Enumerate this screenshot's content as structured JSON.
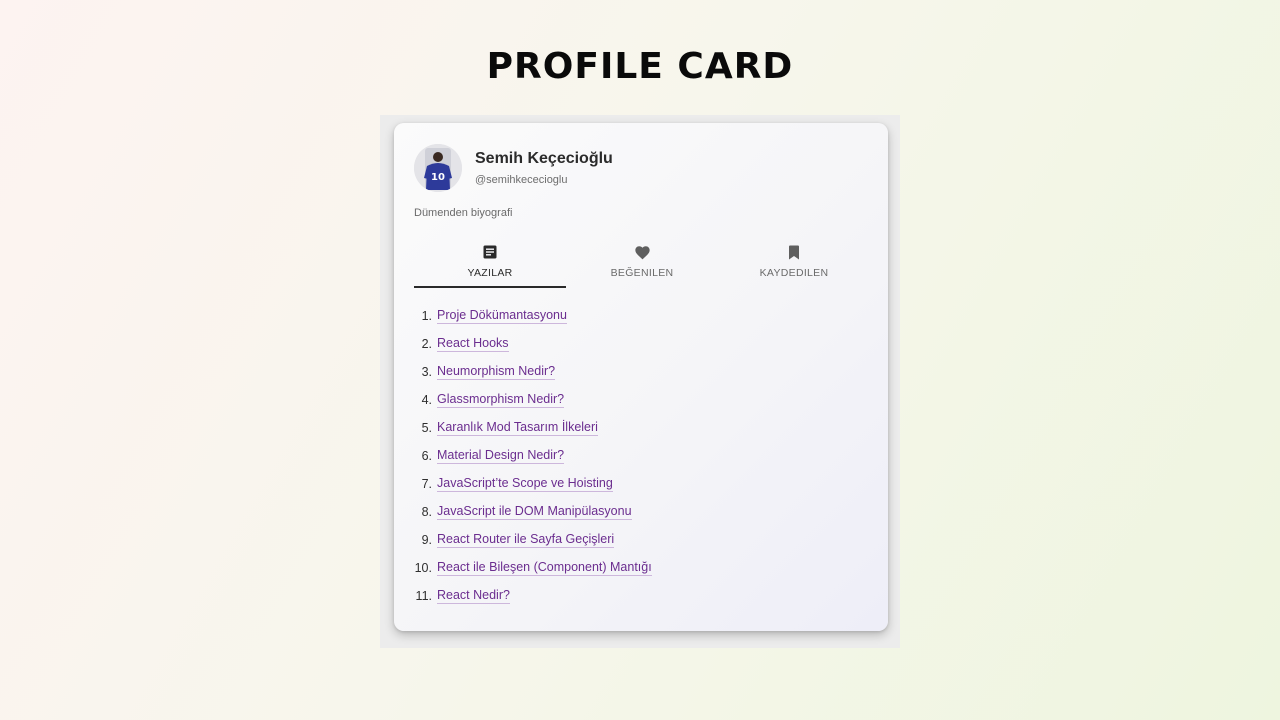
{
  "page": {
    "title": "PROFILE CARD"
  },
  "profile": {
    "name": "Semih Keçecioğlu",
    "handle": "@semihkececioglu",
    "bio": "Dümenden biyografi",
    "avatar_jersey_number": "10"
  },
  "tabs": [
    {
      "label": "YAZILAR",
      "icon": "article-icon",
      "active": true
    },
    {
      "label": "BEĞENILEN",
      "icon": "heart-icon",
      "active": false
    },
    {
      "label": "KAYDEDILEN",
      "icon": "bookmark-icon",
      "active": false
    }
  ],
  "posts": [
    {
      "number": "1.",
      "title": "Proje Dökümantasyonu"
    },
    {
      "number": "2.",
      "title": "React Hooks"
    },
    {
      "number": "3.",
      "title": "Neumorphism Nedir?"
    },
    {
      "number": "4.",
      "title": "Glassmorphism Nedir?"
    },
    {
      "number": "5.",
      "title": "Karanlık Mod Tasarım İlkeleri"
    },
    {
      "number": "6.",
      "title": "Material Design Nedir?"
    },
    {
      "number": "7.",
      "title": "JavaScript’te Scope ve Hoisting"
    },
    {
      "number": "8.",
      "title": "JavaScript ile DOM Manipülasyonu"
    },
    {
      "number": "9.",
      "title": "React Router ile Sayfa Geçişleri"
    },
    {
      "number": "10.",
      "title": "React ile Bileşen (Component) Mantığı"
    },
    {
      "number": "11.",
      "title": "React Nedir?"
    }
  ],
  "colors": {
    "link": "#6b2d8f",
    "active_tab": "#2a2a2a",
    "inactive_tab": "#6a6a6a"
  }
}
